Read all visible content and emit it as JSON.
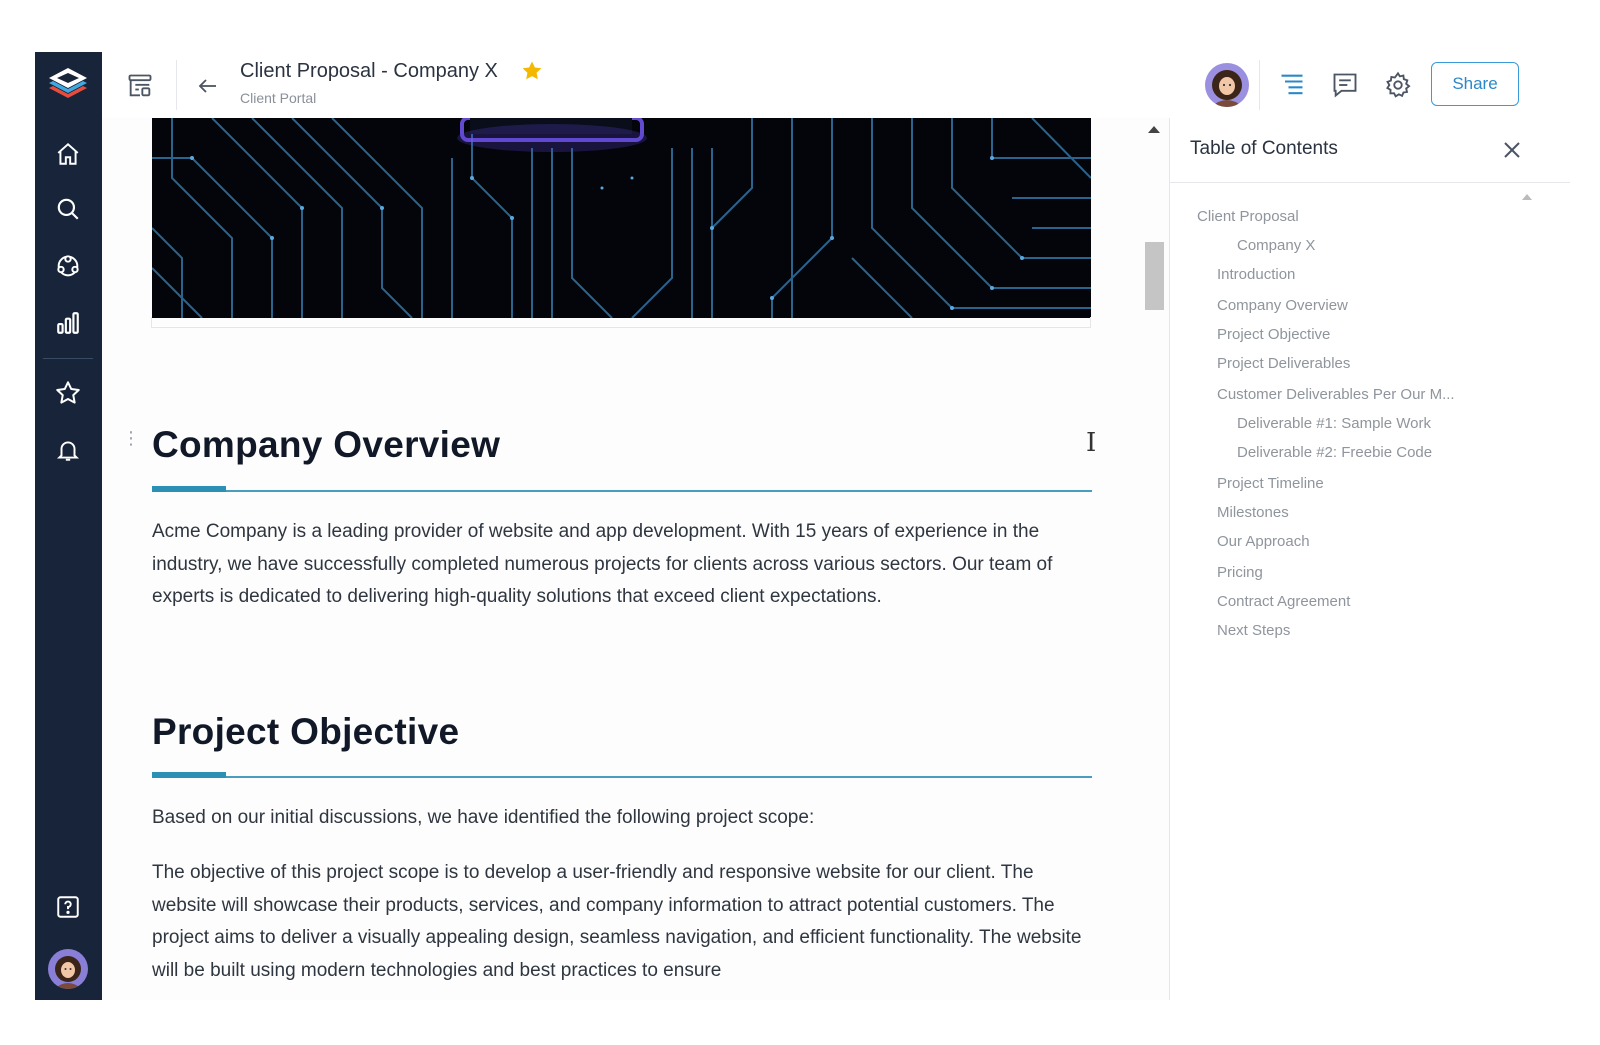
{
  "header": {
    "title": "Client Proposal - Company X",
    "subtitle": "Client Portal",
    "share_label": "Share"
  },
  "nav": {
    "items": [
      "home-icon",
      "search-icon",
      "users-icon",
      "bar-chart-icon",
      "star-icon",
      "bell-icon",
      "help-icon"
    ]
  },
  "document": {
    "sections": [
      {
        "heading": "Company Overview",
        "paragraphs": [
          "Acme Company is a leading provider of website and app development. With 15 years of experience in the industry, we have successfully completed numerous projects for clients across various sectors. Our team of experts is dedicated to delivering high-quality solutions that exceed client expectations."
        ]
      },
      {
        "heading": "Project Objective",
        "paragraphs": [
          "Based on our initial discussions, we have identified the following project scope:",
          "The objective of this project scope is to develop a user-friendly and responsive website for our client. The website will showcase their products, services, and company information to attract potential customers. The project aims to deliver a visually appealing design, seamless navigation, and efficient functionality. The website will be built using modern technologies and best practices to ensure"
        ]
      }
    ]
  },
  "toc": {
    "title": "Table of Contents",
    "items": [
      {
        "label": "Client Proposal",
        "level": 0
      },
      {
        "label": "Company X",
        "level": 2
      },
      {
        "label": "Introduction",
        "level": 1
      },
      {
        "label": "Company Overview",
        "level": 1
      },
      {
        "label": "Project Objective",
        "level": 1
      },
      {
        "label": "Project Deliverables",
        "level": 1
      },
      {
        "label": "Customer Deliverables Per Our M...",
        "level": 1
      },
      {
        "label": "Deliverable #1: Sample Work",
        "level": 2
      },
      {
        "label": "Deliverable #2: Freebie Code",
        "level": 2
      },
      {
        "label": "Project Timeline",
        "level": 1
      },
      {
        "label": "Milestones",
        "level": 1
      },
      {
        "label": "Our Approach",
        "level": 1
      },
      {
        "label": "Pricing",
        "level": 1
      },
      {
        "label": "Contract Agreement",
        "level": 1
      },
      {
        "label": "Next Steps",
        "level": 1
      }
    ]
  },
  "colors": {
    "nav_bg": "#17243a",
    "accent": "#2c8fb4",
    "share_border": "#3b9ad9",
    "star": "#f5b800",
    "toc_text": "#8f959c"
  }
}
